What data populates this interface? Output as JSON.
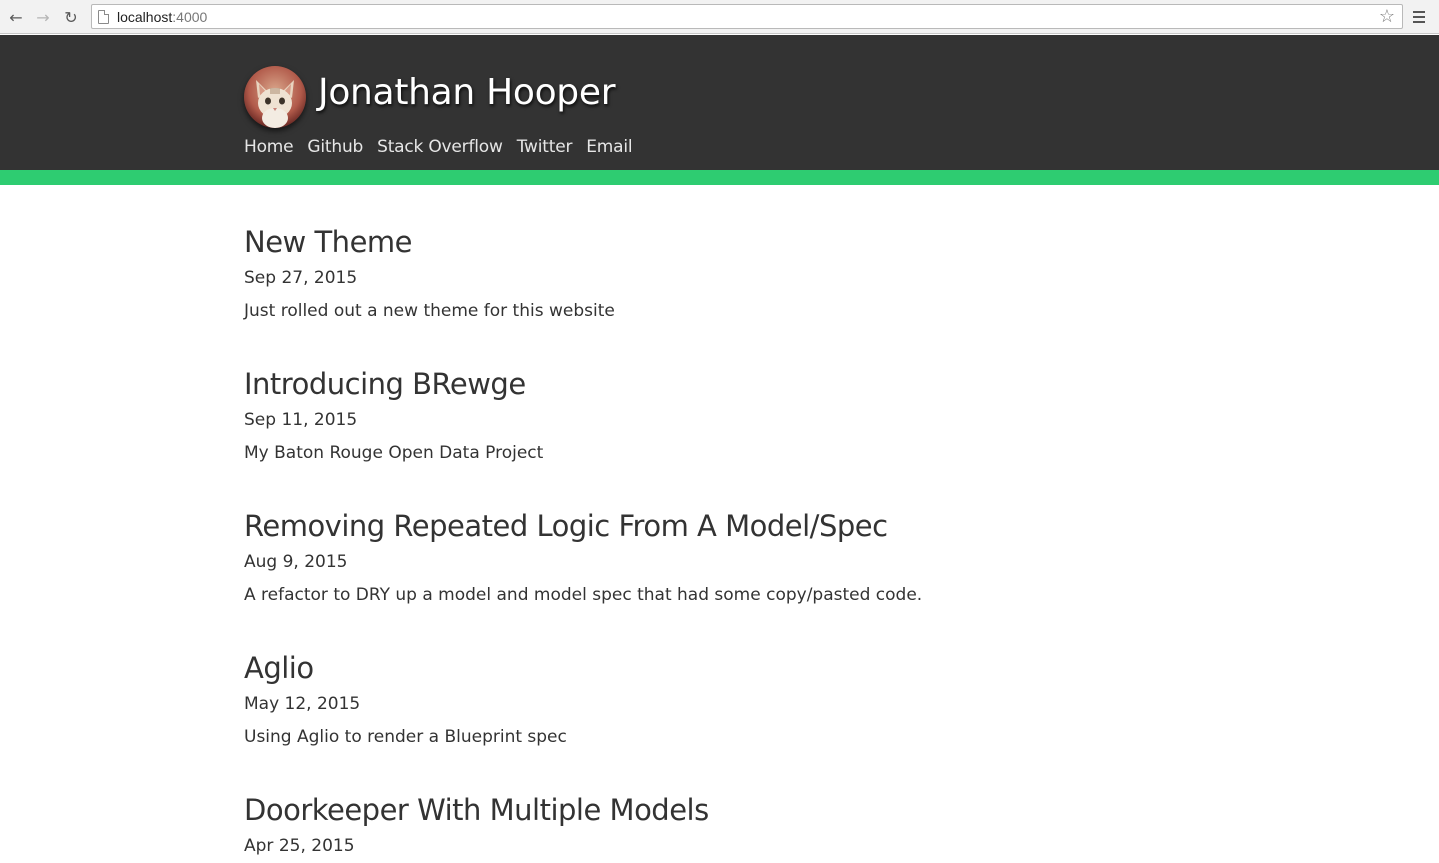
{
  "browser": {
    "url_host": "localhost",
    "url_port": ":4000"
  },
  "site": {
    "title": "Jonathan Hooper",
    "accent_color": "#2ecc71",
    "header_color": "#333333",
    "nav": [
      {
        "label": "Home"
      },
      {
        "label": "Github"
      },
      {
        "label": "Stack Overflow"
      },
      {
        "label": "Twitter"
      },
      {
        "label": "Email"
      }
    ]
  },
  "posts": [
    {
      "title": "New Theme",
      "date": "Sep 27, 2015",
      "summary": "Just rolled out a new theme for this website"
    },
    {
      "title": "Introducing BRewge",
      "date": "Sep 11, 2015",
      "summary": "My Baton Rouge Open Data Project"
    },
    {
      "title": "Removing Repeated Logic From A Model/Spec",
      "date": "Aug 9, 2015",
      "summary": "A refactor to DRY up a model and model spec that had some copy/pasted code."
    },
    {
      "title": "Aglio",
      "date": "May 12, 2015",
      "summary": "Using Aglio to render a Blueprint spec"
    },
    {
      "title": "Doorkeeper With Multiple Models",
      "date": "Apr 25, 2015",
      "summary": ""
    }
  ]
}
